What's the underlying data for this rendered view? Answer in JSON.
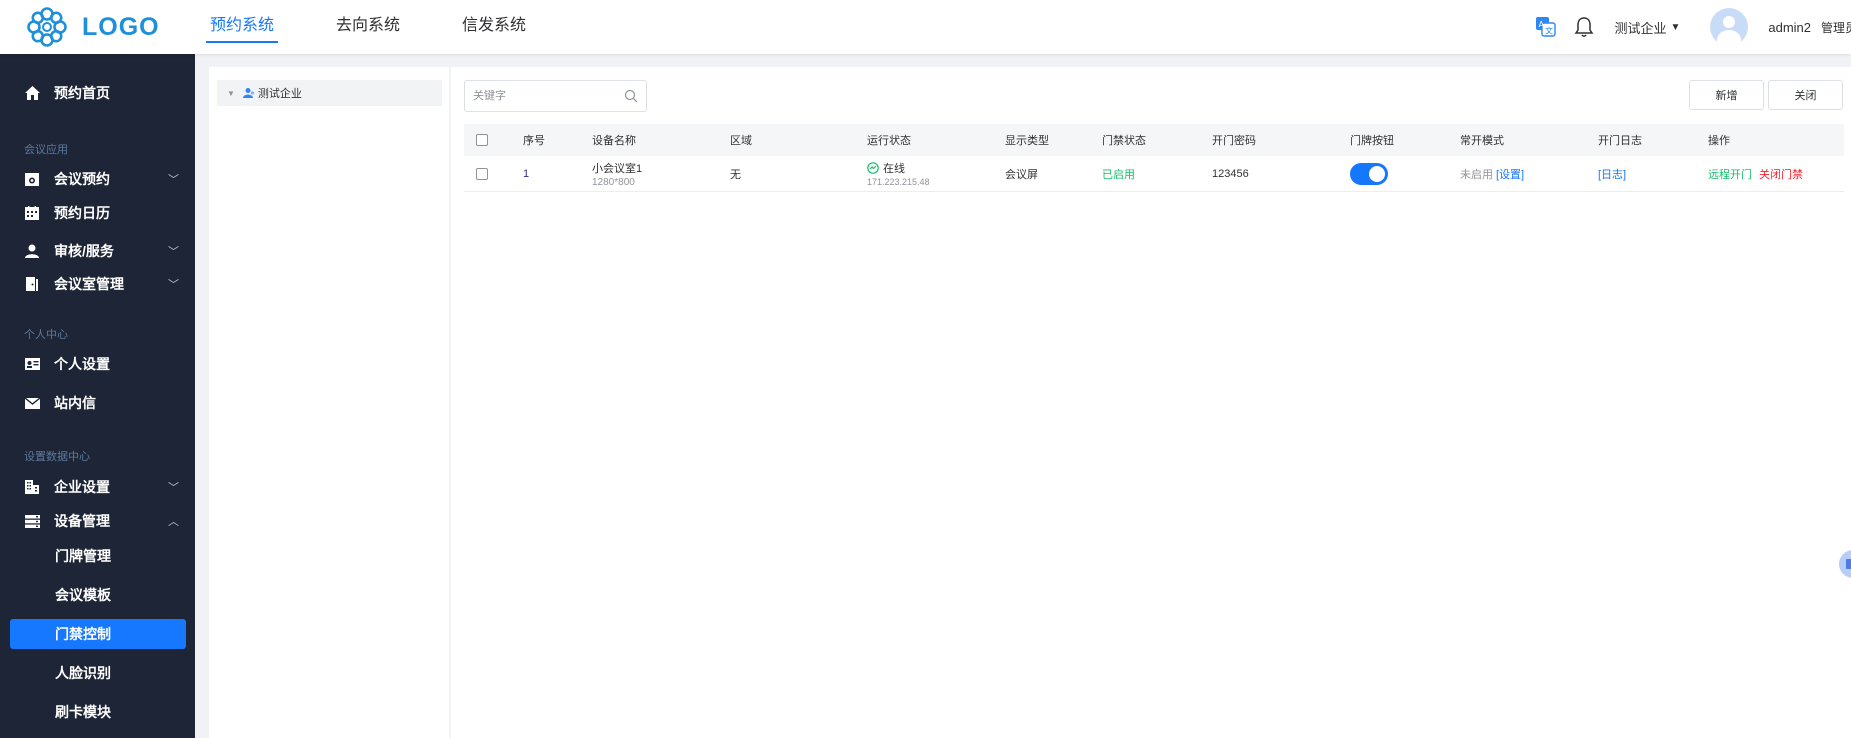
{
  "header": {
    "logo_text": "LOGO",
    "nav": [
      {
        "label": "预约系统",
        "active": true
      },
      {
        "label": "去向系统",
        "active": false
      },
      {
        "label": "信发系统",
        "active": false
      }
    ],
    "company": "测试企业",
    "username": "admin2",
    "role": "管理员"
  },
  "sidebar": {
    "home": "预约首页",
    "group_meeting": "会议应用",
    "meeting_booking": "会议预约",
    "booking_calendar": "预约日历",
    "review_service": "审核/服务",
    "room_management": "会议室管理",
    "group_personal": "个人中心",
    "personal_settings": "个人设置",
    "inbox": "站内信",
    "group_data": "设置数据中心",
    "enterprise_settings": "企业设置",
    "device_management": "设备管理",
    "sub_items": [
      "门牌管理",
      "会议模板",
      "门禁控制",
      "人脸识别",
      "刷卡模块"
    ]
  },
  "tree": {
    "root": "测试企业"
  },
  "toolbar": {
    "search_placeholder": "关键字",
    "add_label": "新增",
    "close_label": "关闭"
  },
  "table": {
    "columns": [
      "序号",
      "设备名称",
      "区域",
      "运行状态",
      "显示类型",
      "门禁状态",
      "开门密码",
      "门牌按钮",
      "常开模式",
      "开门日志",
      "操作"
    ],
    "rows": [
      {
        "index": "1",
        "device_name": "小会议室1",
        "resolution": "1280*800",
        "area": "无",
        "status": "在线",
        "ip": "171.223.215.48",
        "display_type": "会议屏",
        "access_status": "已启用",
        "password": "123456",
        "button_on": true,
        "normally_open": "未启用",
        "normally_open_link": "[设置]",
        "log_link": "[日志]",
        "action_open": "远程开门",
        "action_close": "关闭门禁"
      }
    ]
  },
  "colors": {
    "primary": "#1677ff",
    "sidebar_bg": "#1d2536",
    "success": "#19be6b",
    "danger": "#f5222d",
    "logo": "#1e8fd9"
  }
}
